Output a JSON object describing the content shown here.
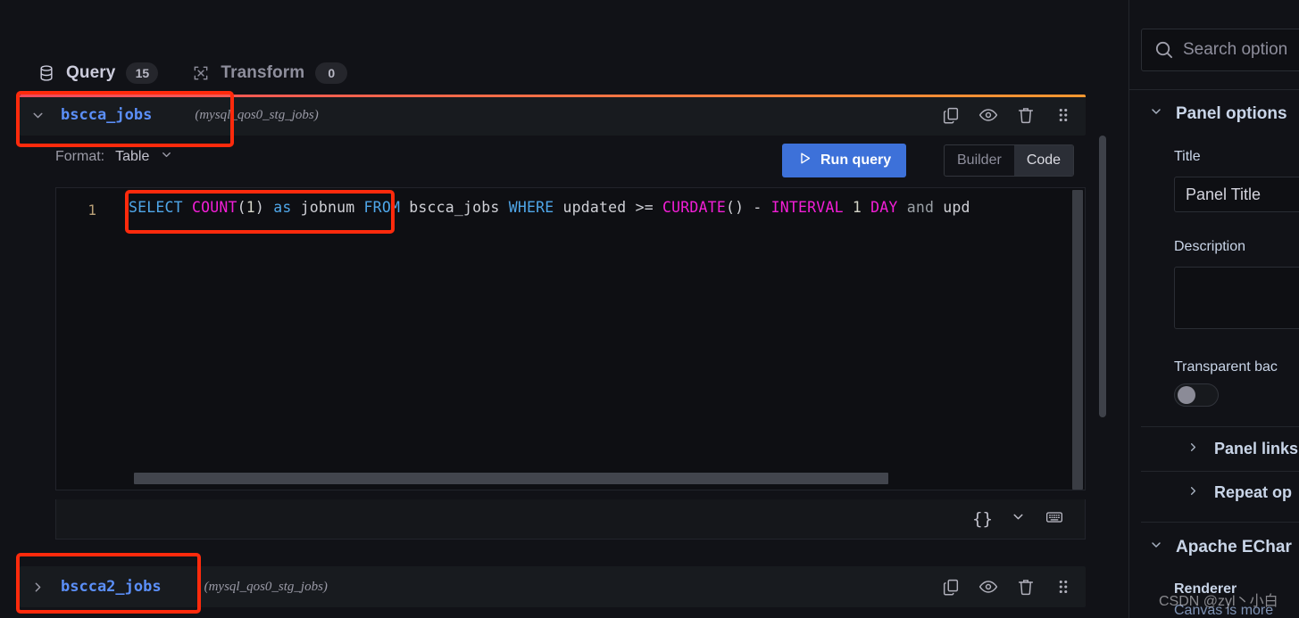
{
  "tabs": [
    {
      "label": "Query",
      "count": "15",
      "icon": "database-icon",
      "active": true
    },
    {
      "label": "Transform",
      "count": "0",
      "icon": "transform-icon",
      "active": false
    }
  ],
  "queries": [
    {
      "name": "bscca_jobs",
      "datasource": "(mysql_qos0_stg_jobs)",
      "expanded": true,
      "caret": "⌄",
      "actions": [
        "copy-icon",
        "eye-icon",
        "trash-icon",
        "drag-handle-icon"
      ]
    },
    {
      "name": "bscca2_jobs",
      "datasource": "(mysql_qos0_stg_jobs)",
      "expanded": false,
      "caret": "›",
      "actions": [
        "copy-icon",
        "eye-icon",
        "trash-icon",
        "drag-handle-icon"
      ]
    }
  ],
  "toolbar": {
    "format_label": "Format:",
    "format_value": "Table",
    "run_query_label": "Run query",
    "builder_label": "Builder",
    "code_label": "Code",
    "active_mode": "Code"
  },
  "editor": {
    "line_number": "1",
    "sql_tokens": [
      {
        "t": "SELECT",
        "c": "k"
      },
      {
        "t": " ",
        "c": "pl"
      },
      {
        "t": "COUNT",
        "c": "fn"
      },
      {
        "t": "(",
        "c": "op"
      },
      {
        "t": "1",
        "c": "num"
      },
      {
        "t": ")",
        "c": "op"
      },
      {
        "t": " ",
        "c": "pl"
      },
      {
        "t": "as",
        "c": "k"
      },
      {
        "t": " jobnum ",
        "c": "pl"
      },
      {
        "t": "FROM",
        "c": "k"
      },
      {
        "t": " bscca_jobs ",
        "c": "pl"
      },
      {
        "t": "WHERE",
        "c": "k"
      },
      {
        "t": " updated ",
        "c": "pl"
      },
      {
        "t": ">=",
        "c": "op"
      },
      {
        "t": " ",
        "c": "pl"
      },
      {
        "t": "CURDATE",
        "c": "fn"
      },
      {
        "t": "()",
        "c": "op"
      },
      {
        "t": " - ",
        "c": "op"
      },
      {
        "t": "INTERVAL",
        "c": "fn"
      },
      {
        "t": " ",
        "c": "pl"
      },
      {
        "t": "1",
        "c": "num"
      },
      {
        "t": " ",
        "c": "pl"
      },
      {
        "t": "DAY",
        "c": "fn"
      },
      {
        "t": " ",
        "c": "pl"
      },
      {
        "t": "and",
        "c": "lw"
      },
      {
        "t": " upd",
        "c": "pl"
      }
    ],
    "sql_plain": "SELECT COUNT(1) as jobnum FROM bscca_jobs WHERE updated >= CURDATE() - INTERVAL 1 DAY and upd",
    "footer_icons": [
      "braces-icon",
      "chevron-down-icon",
      "keyboard-icon"
    ],
    "braces_label": "{}"
  },
  "options": {
    "search_placeholder": "Search option",
    "panel_options_title": "Panel options",
    "title_label": "Title",
    "title_value": "Panel Title",
    "description_label": "Description",
    "description_value": "",
    "transparent_label": "Transparent bac",
    "transparent_on": false,
    "panel_links_label": "Panel links",
    "repeat_options_label": "Repeat op",
    "echarts_title": "Apache EChar",
    "renderer_label": "Renderer",
    "renderer_hint": "Canvas is more"
  },
  "watermark": "CSDN @zyl丶小白",
  "colors": {
    "accent_blue": "#3d71d9",
    "query_name": "#5b8ff9",
    "annotation_red": "#ff2a0c",
    "query_accent_bar": "#ff9830",
    "bg": "#111217",
    "panel_bg": "#181b1f",
    "editor_bg": "#0e0f13"
  }
}
